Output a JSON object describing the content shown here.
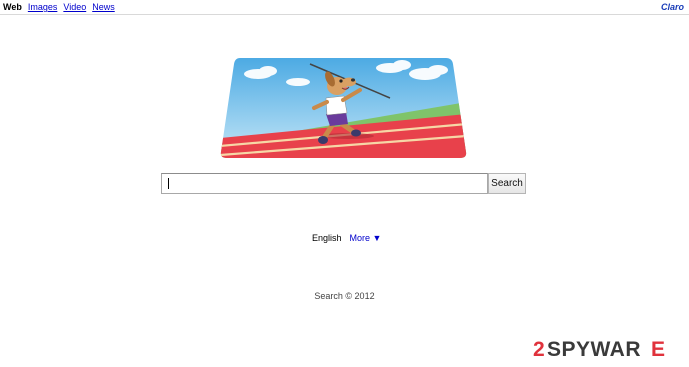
{
  "topbar": {
    "nav": [
      "Web",
      "Images",
      "Video",
      "News"
    ],
    "brand": "Claro"
  },
  "search": {
    "value": "",
    "button_label": "Search"
  },
  "language": {
    "current": "English",
    "more_label": "More ▼"
  },
  "footer": {
    "text": "Search © 2012"
  },
  "watermark": {
    "text_prefix": "2",
    "text_spy": "SPYWAR",
    "text_last": "E"
  },
  "colors": {
    "link": "#0000cc",
    "brand": "#1a3db8",
    "track": "#e8414b",
    "sky": "#7ec8ee",
    "watermark_red": "#e0323c"
  },
  "icons": {
    "doodle": "javelin-thrower-dog-doodle-icon"
  }
}
